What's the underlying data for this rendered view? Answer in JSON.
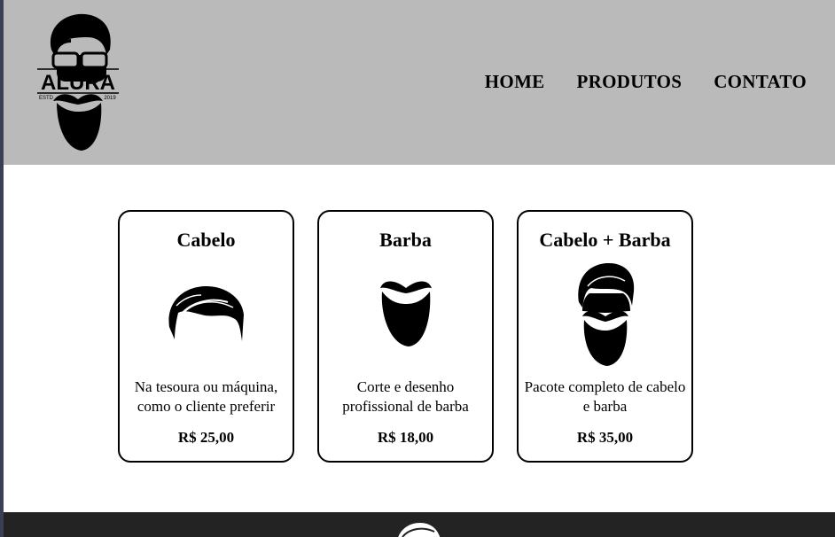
{
  "header": {
    "logo": {
      "brand": "ALURA",
      "left_text": "ESTD",
      "right_text": "2019",
      "icon": "bearded-man-logo"
    },
    "nav": [
      "HOME",
      "PRODUTOS",
      "CONTATO"
    ]
  },
  "products": [
    {
      "title": "Cabelo",
      "icon": "hair-icon",
      "description": "Na tesoura ou máquina, como o cliente preferir",
      "price": "R$ 25,00"
    },
    {
      "title": "Barba",
      "icon": "beard-icon",
      "description": "Corte e desenho profissional de barba",
      "price": "R$ 18,00"
    },
    {
      "title": "Cabelo + Barba",
      "icon": "hair-beard-icon",
      "description": "Pacote completo de cabelo e barba",
      "price": "R$ 35,00"
    }
  ],
  "footer": {
    "icon": "hair-icon"
  },
  "colors": {
    "header_bg": "#bababa",
    "footer_bg": "#232323",
    "text": "#000000"
  }
}
